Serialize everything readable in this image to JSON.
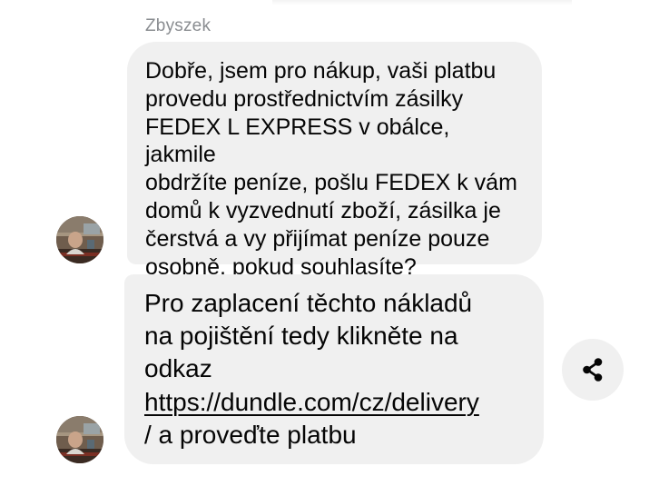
{
  "conversation": {
    "sender_name": "Zbyszek",
    "messages": [
      {
        "text": "Dobře, jsem pro nákup, vaši platbu\nprovedu prostřednictvím zásilky\nFEDEX L EXPRESS v obálce, jakmile\nobdržíte peníze, pošlu FEDEX k vám\ndomů k vyzvednutí zboží, zásilka je\nčerstvá a vy přijímat peníze pouze\nosobně, pokud souhlasíte?"
      },
      {
        "text_before_link": "Pro zaplacení těchto nákladů\nna pojištění tedy klikněte na\nodkaz\n",
        "link": "https://dundle.com/cz/delivery",
        "text_after_link": "\n/ a proveďte platbu"
      }
    ]
  },
  "icons": {
    "avatar": "avatar-photo",
    "share": "share-icon"
  },
  "colors": {
    "bubble_background": "#f0f0f0",
    "text": "#050505",
    "sender_name": "#8a8d91"
  }
}
